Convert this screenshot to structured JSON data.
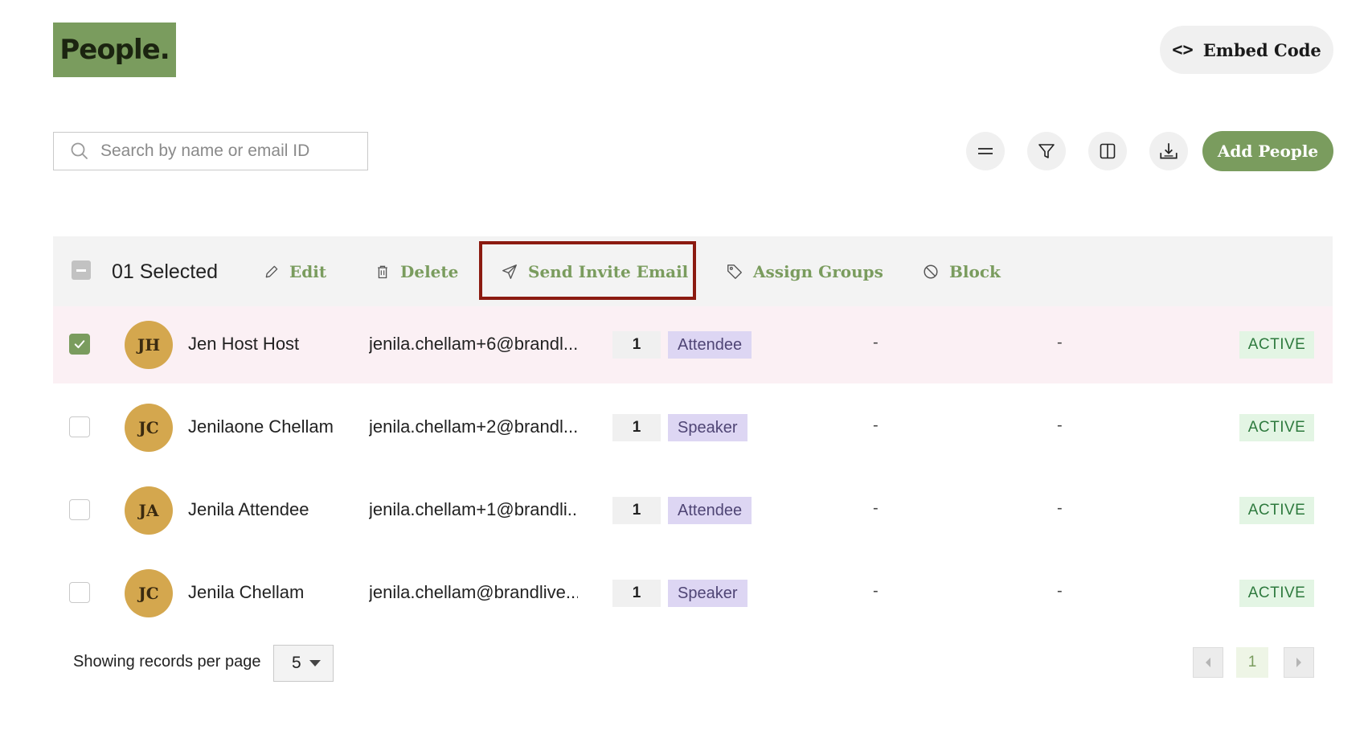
{
  "header": {
    "logo_text": "People.",
    "embed_label": "Embed Code"
  },
  "toolbar": {
    "search_placeholder": "Search by name or email ID",
    "search_value": "",
    "add_label": "Add People",
    "icons": [
      "menu-icon",
      "filter-icon",
      "columns-icon",
      "download-icon"
    ]
  },
  "bulk": {
    "selected_label": "01 Selected",
    "actions": [
      {
        "label": "Edit",
        "icon": "pencil-icon"
      },
      {
        "label": "Delete",
        "icon": "trash-icon"
      },
      {
        "label": "Send Invite Email",
        "icon": "send-icon",
        "highlighted": true
      },
      {
        "label": "Assign Groups",
        "icon": "tag-icon"
      },
      {
        "label": "Block",
        "icon": "block-icon"
      }
    ]
  },
  "rows": [
    {
      "initials": "JH",
      "name": "Jen Host Host",
      "email": "jenila.chellam+6@brandl...",
      "count": "1",
      "role": "Attendee",
      "col1": "-",
      "col2": "-",
      "status": "ACTIVE",
      "checked": true
    },
    {
      "initials": "JC",
      "name": "Jenilaone Chellam",
      "email": "jenila.chellam+2@brandl...",
      "count": "1",
      "role": "Speaker",
      "col1": "-",
      "col2": "-",
      "status": "ACTIVE",
      "checked": false
    },
    {
      "initials": "JA",
      "name": "Jenila Attendee",
      "email": "jenila.chellam+1@brandli...",
      "count": "1",
      "role": "Attendee",
      "col1": "-",
      "col2": "-",
      "status": "ACTIVE",
      "checked": false
    },
    {
      "initials": "JC",
      "name": "Jenila Chellam",
      "email": "jenila.chellam@brandlive...",
      "count": "1",
      "role": "Speaker",
      "col1": "-",
      "col2": "-",
      "status": "ACTIVE",
      "checked": false
    }
  ],
  "footer": {
    "per_page_label": "Showing records per page",
    "per_page_value": "5",
    "current_page": "1"
  },
  "colors": {
    "brand_green": "#7a9c5e",
    "highlight_border": "#8b1a10",
    "avatar_gold": "#d4a74e",
    "selected_row_bg": "#fbf0f4",
    "status_bg": "#e3f5e4"
  }
}
